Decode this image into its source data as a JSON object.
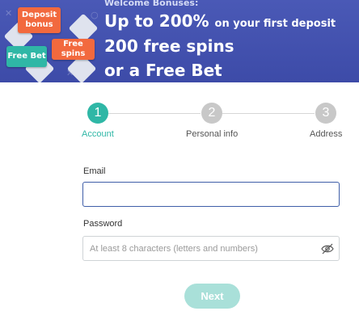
{
  "banner": {
    "welcome": "Welcome Bonuses:",
    "line1_big": "Up to 200%",
    "line1_small": "on your first deposit",
    "line2": "200 free spins",
    "line3": "or a Free Bet",
    "tags": {
      "deposit": "Deposit bonus",
      "free_bet": "Free Bet",
      "free_spins": "Free spins"
    },
    "colors": {
      "background": "#4a59b6",
      "orange_tag": "#f2693e",
      "teal_tag": "#2fb7a6"
    }
  },
  "steps": [
    {
      "number": "1",
      "label": "Account",
      "state": "active"
    },
    {
      "number": "2",
      "label": "Personal info",
      "state": "inactive"
    },
    {
      "number": "3",
      "label": "Address",
      "state": "inactive"
    }
  ],
  "form": {
    "email": {
      "label": "Email",
      "value": "",
      "placeholder": ""
    },
    "password": {
      "label": "Password",
      "value": "",
      "placeholder": "At least 8 characters (letters and numbers)"
    },
    "next_label": "Next"
  },
  "colors": {
    "accent": "#2fb7a6",
    "inactive_step": "#c8c8c8",
    "input_focus": "#3f5ea8"
  }
}
